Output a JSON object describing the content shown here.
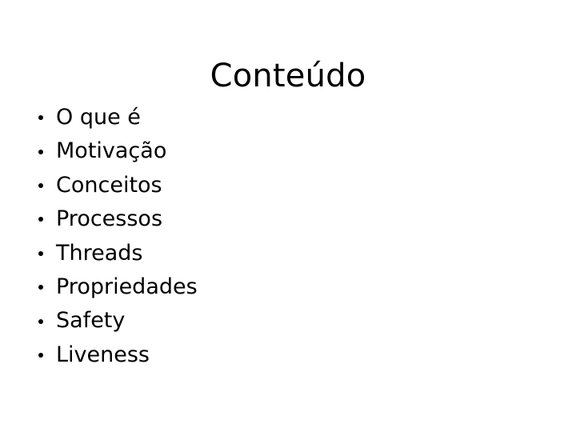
{
  "slide": {
    "title": "Conteúdo",
    "background_color": "#FFFFFF",
    "text_color": "#000000",
    "bullet_marker": "round-bullet",
    "items": [
      {
        "label": "O que é"
      },
      {
        "label": "Motivação"
      },
      {
        "label": "Conceitos"
      },
      {
        "label": "Processos"
      },
      {
        "label": "Threads"
      },
      {
        "label": "Propriedades"
      },
      {
        "label": "Safety"
      },
      {
        "label": "Liveness"
      }
    ]
  }
}
